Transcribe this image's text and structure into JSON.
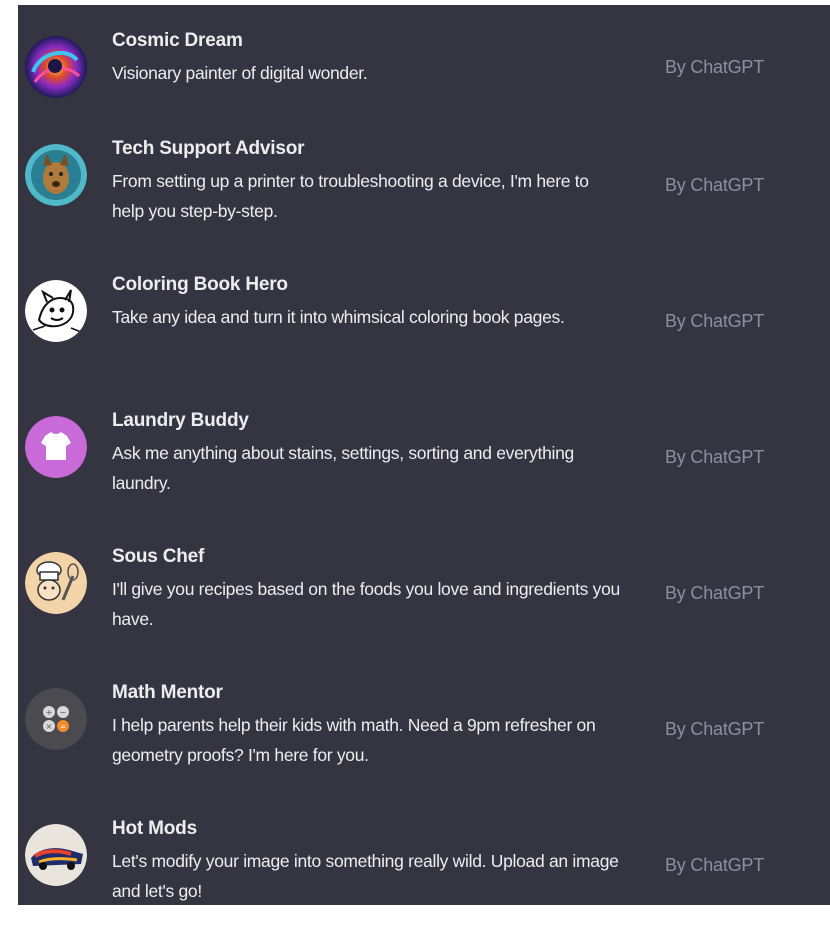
{
  "gpts": [
    {
      "name": "Cosmic Dream",
      "description": "Visionary painter of digital wonder.",
      "author": "By ChatGPT",
      "icon": "cosmic-swirl-icon"
    },
    {
      "name": "Tech Support Advisor",
      "description": "From setting up a printer to troubleshooting a device, I'm here to help you step-by-step.",
      "author": "By ChatGPT",
      "icon": "dog-avatar-icon"
    },
    {
      "name": "Coloring Book Hero",
      "description": "Take any idea and turn it into whimsical coloring book pages.",
      "author": "By ChatGPT",
      "icon": "sketch-creature-icon"
    },
    {
      "name": "Laundry Buddy",
      "description": "Ask me anything about stains, settings, sorting and everything laundry.",
      "author": "By ChatGPT",
      "icon": "tshirt-icon"
    },
    {
      "name": "Sous Chef",
      "description": "I'll give you recipes based on the foods you love and ingredients you have.",
      "author": "By ChatGPT",
      "icon": "chef-whisk-icon"
    },
    {
      "name": "Math Mentor",
      "description": "I help parents help their kids with math. Need a 9pm refresher on geometry proofs? I'm here for you.",
      "author": "By ChatGPT",
      "icon": "calculator-icon"
    },
    {
      "name": "Hot Mods",
      "description": "Let's modify your image into something really wild. Upload an image and let's go!",
      "author": "By ChatGPT",
      "icon": "hot-car-icon"
    }
  ]
}
